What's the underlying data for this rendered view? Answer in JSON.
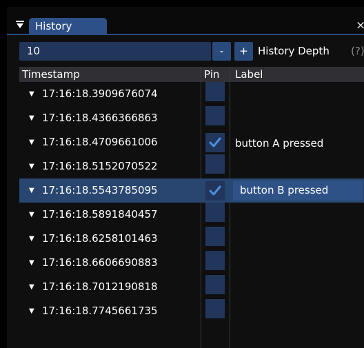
{
  "window": {
    "tab_title": "History",
    "close_glyph": "×",
    "collapse_glyph": "triangle-down"
  },
  "depth_control": {
    "value": "10",
    "minus_label": "-",
    "plus_label": "+",
    "label": "History Depth",
    "help": "(?)"
  },
  "table": {
    "columns": [
      "Timestamp",
      "Pin",
      "Label"
    ],
    "rows": [
      {
        "timestamp": "17:16:18.3909676074",
        "pinned": false,
        "label": "",
        "selected": false
      },
      {
        "timestamp": "17:16:18.4366366863",
        "pinned": false,
        "label": "",
        "selected": false
      },
      {
        "timestamp": "17:16:18.4709661006",
        "pinned": true,
        "label": "button A pressed",
        "selected": false
      },
      {
        "timestamp": "17:16:18.5152070522",
        "pinned": false,
        "label": "",
        "selected": false
      },
      {
        "timestamp": "17:16:18.5543785095",
        "pinned": true,
        "label": "button B pressed",
        "selected": true
      },
      {
        "timestamp": "17:16:18.5891840457",
        "pinned": false,
        "label": "",
        "selected": false
      },
      {
        "timestamp": "17:16:18.6258101463",
        "pinned": false,
        "label": "",
        "selected": false
      },
      {
        "timestamp": "17:16:18.6606690883",
        "pinned": false,
        "label": "",
        "selected": false
      },
      {
        "timestamp": "17:16:18.7012190818",
        "pinned": false,
        "label": "",
        "selected": false
      },
      {
        "timestamp": "17:16:18.7745661735",
        "pinned": false,
        "label": "",
        "selected": false
      }
    ]
  },
  "colors": {
    "accent": "#2d5088",
    "frame_bg": "#21365a",
    "selected_row": "#28466f",
    "check": "#4a90e2",
    "window_bg": "#0f0f0f",
    "header_bg": "#2f2f34"
  }
}
